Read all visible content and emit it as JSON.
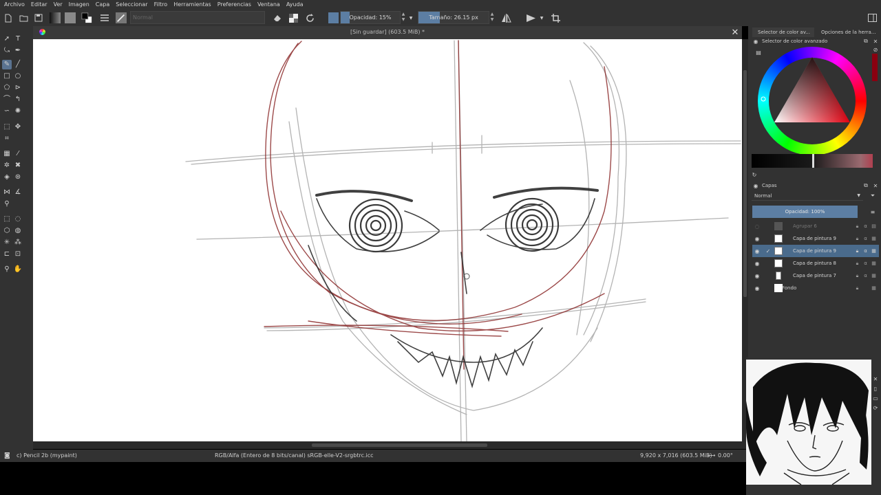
{
  "menu": [
    "Archivo",
    "Editar",
    "Ver",
    "Imagen",
    "Capa",
    "Seleccionar",
    "Filtro",
    "Herramientas",
    "Preferencias",
    "Ventana",
    "Ayuda"
  ],
  "toolbar": {
    "blend_mode": "Normal",
    "opacity_label": "Opacidad: 15%",
    "opacity_level": 0.15,
    "size_label": "Tamaño: 26.15 px",
    "size_level": 0.3
  },
  "document": {
    "title": "[Sin guardar]  (603.5 MiB) *"
  },
  "right_dock": {
    "tabs": [
      "Selector de color av...",
      "Opciones de la herra..."
    ],
    "color_panel_title": "Selector de color avanzado",
    "layers_panel_title": "Capas",
    "layer_blend_mode": "Normal",
    "layer_opacity_label": "Opacidad:  100%",
    "layer_opacity_level": 1.0,
    "layers": [
      {
        "name": "Agrupar 6",
        "visible": false,
        "selected": false
      },
      {
        "name": "Capa de pintura 9",
        "visible": true,
        "selected": false
      },
      {
        "name": "Capa de pintura 9",
        "visible": true,
        "selected": true
      },
      {
        "name": "Capa de pintura 8",
        "visible": true,
        "selected": false
      },
      {
        "name": "Capa de pintura 7",
        "visible": true,
        "selected": false
      },
      {
        "name": "Fondo",
        "visible": true,
        "selected": false
      }
    ]
  },
  "status": {
    "brush": "c) Pencil 2b (mypaint)",
    "color_profile": "RGB/Alfa (Entero de 8 bits/canal)  sRGB-elle-V2-srgbtrc.icc",
    "dimensions": "9,920 x 7,016 (603.5 MiB)",
    "rotation": "0.00°"
  },
  "colors": {
    "accent": "#5c7ea3",
    "sketch_red": "#8b2a2a",
    "panel_bg": "#323232"
  }
}
